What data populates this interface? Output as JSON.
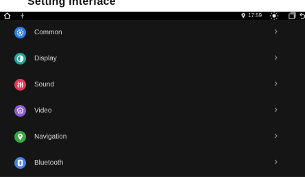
{
  "header": {
    "title": "Setting Interface"
  },
  "status": {
    "time": "17:59"
  },
  "icons": {
    "home": "home-icon",
    "usb": "usb-icon",
    "location": "location-pin-icon",
    "brightness": "brightness-icon",
    "window": "window-icon",
    "back": "back-icon"
  },
  "menu": {
    "items": [
      {
        "label": "Common",
        "icon": "gear-icon",
        "color": "#2f7de1"
      },
      {
        "label": "Display",
        "icon": "display-icon",
        "color": "#26a69a"
      },
      {
        "label": "Sound",
        "icon": "equalizer-icon",
        "color": "#e5395b"
      },
      {
        "label": "Video",
        "icon": "video-icon",
        "color": "#8e5cd6"
      },
      {
        "label": "Navigation",
        "icon": "location-icon",
        "color": "#3aa842"
      },
      {
        "label": "Bluetooth",
        "icon": "bluetooth-icon",
        "color": "#4a7fe6"
      }
    ]
  },
  "colors": {
    "row_bg": "#151515",
    "text": "#d8d8d8",
    "chevron": "#9a9a9a"
  }
}
